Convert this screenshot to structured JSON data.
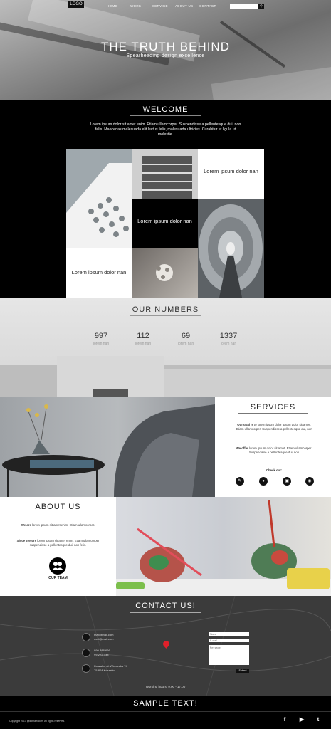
{
  "nav": {
    "logo": "LOGO",
    "items": [
      "HOME",
      "WORK",
      "SERVICE",
      "ABOUT US",
      "CONTACT"
    ],
    "search_placeholder": ""
  },
  "hero": {
    "title": "THE TRUTH BEHIND",
    "subtitle": "Spearheading design excellence"
  },
  "welcome": {
    "title": "WELCOME",
    "text": "Lorem ipsum dolor sit amet enim. Etiam ullamcorper. Suspendisse a pellentesque dui, non felis. Maecenas malesuada elit lectus felis, malesuada ultricies. Curabitur et ligula ut molestie.",
    "tiles": [
      "Lorem ipsum dolor nan",
      "Lorem ipsum dolor nan",
      "Lorem ipsum dolor nan"
    ]
  },
  "numbers": {
    "title": "OUR NUMBERS",
    "items": [
      {
        "value": "997",
        "label": "lorem nan"
      },
      {
        "value": "112",
        "label": "lorem nan"
      },
      {
        "value": "69",
        "label": "lorem nan"
      },
      {
        "value": "1337",
        "label": "lorem nan"
      }
    ]
  },
  "services": {
    "title": "SERVICES",
    "p1_bold": "Our goal is",
    "p1": " to lorem ipsum dolor ipsum dolor sit amet. Etiam ullamcorper. Suspendisse a pellentesque dui, non",
    "p2_bold": "We offer",
    "p2": " lorem ipsum dolor sit amet. Etiam ullamcorper. Suspendisse a pellentesque dui, non",
    "checkout": "Check out:",
    "icons": [
      "pen-icon",
      "gamepad-icon",
      "tv-icon",
      "disc-icon"
    ]
  },
  "about": {
    "title": "ABOUT US",
    "p1_bold": "We are",
    "p1": " lorem ipsum sit amet enim. Etiam ullamcorper.",
    "p2_bold": "Since 6 years",
    "p2": " lorem ipsum sit amet enim. Etiam ullamcorper suspendisse a pellentesque dui, non felis.",
    "team_label": "OUR TEAM"
  },
  "contact": {
    "title": "CONTACT US!",
    "emails": [
      "mail@mail.com",
      "mail@mail.com"
    ],
    "phones": [
      "999-888-666",
      "99-222-333"
    ],
    "address": [
      "Koszalin, ul. Wieniecka 74",
      "75-804 Koszalin"
    ],
    "form": {
      "name_ph": "Name",
      "email_ph": "E-mail",
      "message_ph": "Message",
      "submit": "Submit"
    },
    "hours": "Working hours: 9:00 - 17:00"
  },
  "footer": {
    "sample": "SAMPLE TEXT!",
    "copyright": "Copyright 2017 @domain.com. All rights reserved.",
    "socials": [
      "facebook-icon",
      "youtube-icon",
      "twitter-icon"
    ]
  },
  "colors": {
    "dark": "#000000",
    "accent_pin": "#e0202a"
  }
}
